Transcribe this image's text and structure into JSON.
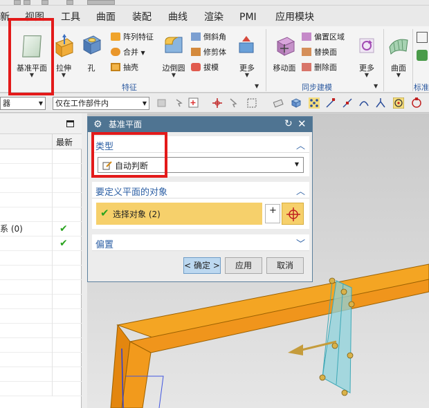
{
  "menu": {
    "tabs": [
      "新",
      "视图",
      "工具",
      "曲面",
      "装配",
      "曲线",
      "渲染",
      "PMI",
      "应用模块"
    ]
  },
  "ribbon": {
    "datum_plane": "基准平面",
    "extrude": "拉伸",
    "hole": "孔",
    "pattern_feature": "阵列特征",
    "unite": "合并",
    "shell": "抽壳",
    "edge_blend": "边倒圆",
    "chamfer": "倒斜角",
    "trim_body": "修剪体",
    "draft": "拔模",
    "more_feature": "更多",
    "feature_group": "特征",
    "move_face": "移动面",
    "offset_region": "偏置区域",
    "replace_face": "替换面",
    "delete_face": "删除面",
    "more_sync": "更多",
    "sync_group": "同步建模",
    "surface": "曲面",
    "standard_group": "标准"
  },
  "toolbar": {
    "filter_combo": "器",
    "scope_combo": "仅在工作部件内"
  },
  "navigator": {
    "col_latest": "最新",
    "rows": [
      {
        "name": "",
        "check": false
      },
      {
        "name": "",
        "check": false
      },
      {
        "name": "",
        "check": false
      },
      {
        "name": "",
        "check": false
      },
      {
        "name": "",
        "check": false
      },
      {
        "name": "系 (0)",
        "check": true
      },
      {
        "name": "",
        "check": true
      }
    ]
  },
  "dialog": {
    "title": "基准平面",
    "type_section": "类型",
    "type_value": "自动判断",
    "objects_section": "要定义平面的对象",
    "select_objects": "选择对象 (2)",
    "offset_section": "偏置",
    "ok": "< 确定 >",
    "apply": "应用",
    "cancel": "取消"
  },
  "colors": {
    "highlight": "#e31a1a",
    "dialog_title": "#4f7492",
    "section_text": "#2c5fa4",
    "select_bar": "#f6d06b",
    "part_orange": "#f29a1c"
  }
}
